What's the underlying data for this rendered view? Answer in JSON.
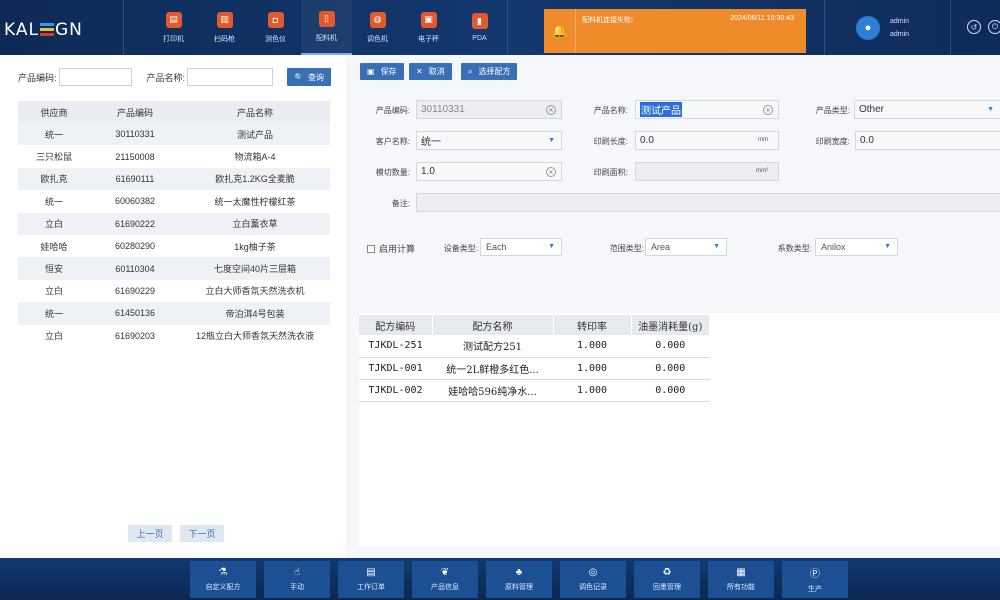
{
  "header": {
    "logo": {
      "prefix": "KAL",
      "suffix": "GN",
      "stripe_colors": [
        "#2e9be6",
        "#e9c22b",
        "#d83a3a"
      ]
    },
    "tools": [
      {
        "label": "打印机",
        "icon": "printer-icon",
        "glyph": "▤"
      },
      {
        "label": "扫码枪",
        "icon": "scanner-icon",
        "glyph": "▥"
      },
      {
        "label": "测色仪",
        "icon": "colorimeter-icon",
        "glyph": "◘"
      },
      {
        "label": "配料机",
        "icon": "dispenser-icon",
        "glyph": "▯",
        "active": true
      },
      {
        "label": "调色机",
        "icon": "mixer-icon",
        "glyph": "◍"
      },
      {
        "label": "电子秤",
        "icon": "scale-icon",
        "glyph": "▣"
      },
      {
        "label": "PDA",
        "icon": "pda-icon",
        "glyph": "▮"
      }
    ],
    "alert": {
      "message": "配料机连接失败!",
      "time": "2024/06/11 10:30:43",
      "color": "#f08b2c"
    },
    "user": {
      "name1": "admin",
      "name2": "admin"
    }
  },
  "search": {
    "code_label": "产品编码:",
    "name_label": "产品名称:",
    "code_value": "",
    "name_value": "",
    "query_label": "查询"
  },
  "product_table": {
    "headers": [
      "供应商",
      "产品编码",
      "产品名称"
    ],
    "rows": [
      [
        "统一",
        "30110331",
        "测试产品"
      ],
      [
        "三只松鼠",
        "21150008",
        "物流箱A-4"
      ],
      [
        "欧扎克",
        "61690111",
        "欧扎克1.2KG全麦脆"
      ],
      [
        "统一",
        "60060382",
        "统一太魔性柠檬红茶"
      ],
      [
        "立白",
        "61690222",
        "立白薰衣草"
      ],
      [
        "娃哈哈",
        "60280290",
        "1kg柚子茶"
      ],
      [
        "恒安",
        "60110304",
        "七度空间40片三层箱"
      ],
      [
        "立白",
        "61690229",
        "立白大师香氛天然洗衣机"
      ],
      [
        "统一",
        "61450136",
        "帝泊洱4号包装"
      ],
      [
        "立白",
        "61690203",
        "12瓶立白大师香氛天然洗衣液"
      ]
    ]
  },
  "pager": {
    "prev": "上一页",
    "next": "下一页"
  },
  "toolbar": {
    "save": "保存",
    "cancel": "取消",
    "select_recipe": "选择配方"
  },
  "form": {
    "product_code_label": "产品编码:",
    "product_code": "30110331",
    "product_name_label": "产品名称:",
    "product_name": "测试产品",
    "product_type_label": "产品类型:",
    "product_type": "Other",
    "customer_label": "客户名称:",
    "customer": "统一",
    "print_length_label": "印刷长度:",
    "print_length": "0.0",
    "print_width_label": "印刷宽度:",
    "print_width": "0.0",
    "cut_count_label": "模切数量:",
    "cut_count": "1.0",
    "print_area_label": "印刷面积:",
    "print_area": "",
    "remark_label": "备注:",
    "remark": "",
    "unit_mm": "mm",
    "unit_mm2": "mm²",
    "enable_calc_label": "启用计算",
    "device_type_label": "设备类型:",
    "device_type": "Each",
    "range_type_label": "范围类型:",
    "range_type": "Area",
    "coef_type_label": "系数类型:",
    "coef_type": "Anilox"
  },
  "recipe_table": {
    "headers": [
      "配方编码",
      "配方名称",
      "转印率",
      "油墨消耗量(g)"
    ],
    "rows": [
      [
        "TJKDL-251",
        "测试配方251",
        "1.000",
        "0.000"
      ],
      [
        "TJKDL-001",
        "统一2L鲜橙多红色...",
        "1.000",
        "0.000"
      ],
      [
        "TJKDL-002",
        "娃哈哈596纯净水...",
        "1.000",
        "0.000"
      ]
    ]
  },
  "bottom_nav": [
    {
      "label": "自定义配方",
      "icon": "flask-icon",
      "glyph": "⚗"
    },
    {
      "label": "手动",
      "icon": "hand-icon",
      "glyph": "☝"
    },
    {
      "label": "工作订单",
      "icon": "order-icon",
      "glyph": "▤"
    },
    {
      "label": "产品信息",
      "icon": "leaf-icon",
      "glyph": "❦"
    },
    {
      "label": "原料管理",
      "icon": "sprout-icon",
      "glyph": "♣"
    },
    {
      "label": "调色记录",
      "icon": "palette-icon",
      "glyph": "◎"
    },
    {
      "label": "回墨管理",
      "icon": "recycle-icon",
      "glyph": "♻"
    },
    {
      "label": "所有功能",
      "icon": "grid-icon",
      "glyph": "▦"
    },
    {
      "label": "生产",
      "icon": "production-icon",
      "glyph": "Ⓟ"
    }
  ]
}
